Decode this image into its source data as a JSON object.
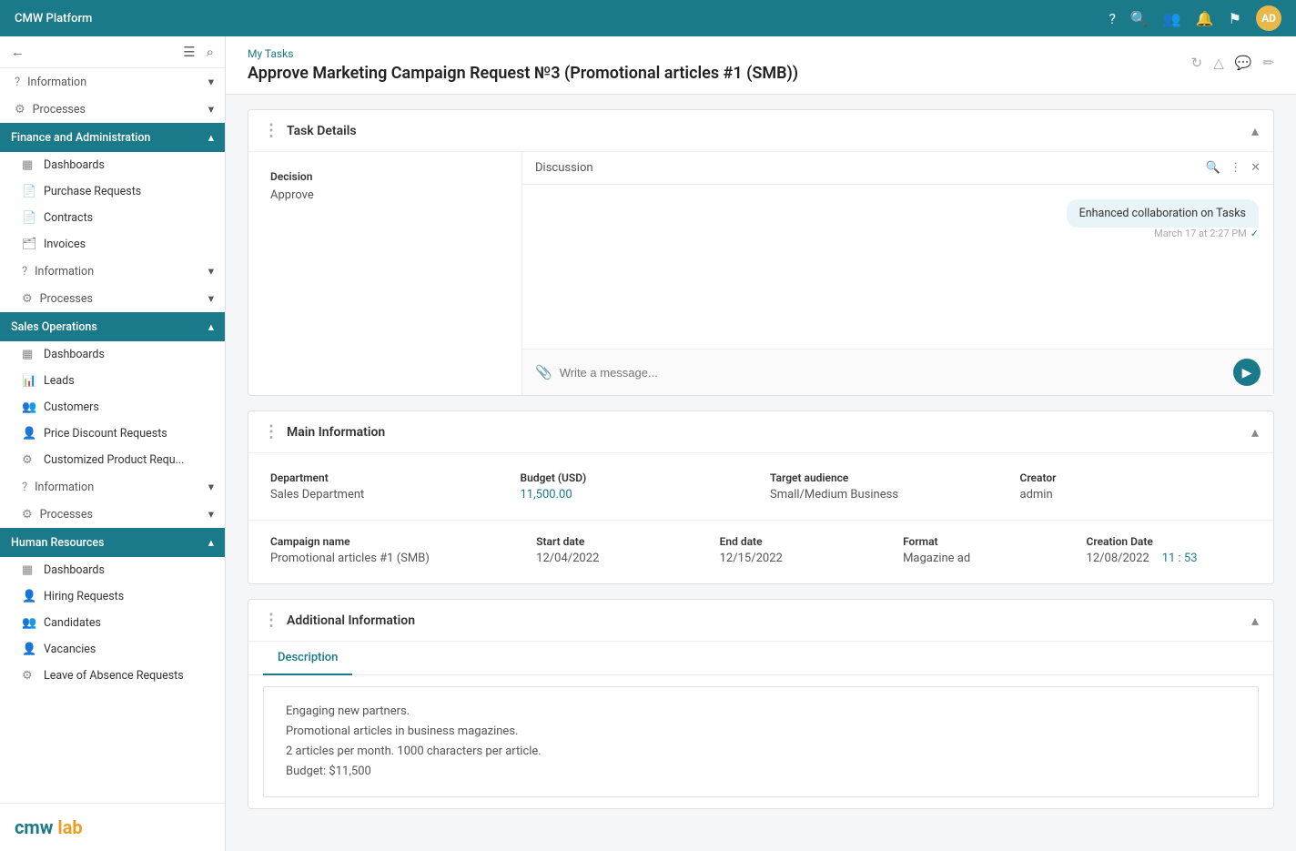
{
  "topbar": {
    "title": "CMW Platform",
    "avatar_initials": "AD"
  },
  "sidebar": {
    "logo_text": "cmw ",
    "logo_highlight": "lab",
    "back_icon": "←",
    "menu_icon": "☰",
    "search_icon": "🔍",
    "sections": [
      {
        "id": "information-top",
        "label": "Information",
        "active": false,
        "has_arrow": true,
        "type": "subsection"
      },
      {
        "id": "processes-top",
        "label": "Processes",
        "active": false,
        "has_arrow": true,
        "type": "subsection"
      },
      {
        "id": "finance",
        "label": "Finance and Administration",
        "active": true,
        "type": "section",
        "items": [
          {
            "id": "dashboards-fin",
            "label": "Dashboards",
            "icon": "▦"
          },
          {
            "id": "purchase-requests",
            "label": "Purchase Requests",
            "icon": "📄"
          },
          {
            "id": "contracts",
            "label": "Contracts",
            "icon": "📄"
          },
          {
            "id": "invoices",
            "label": "Invoices",
            "icon": "🗂"
          },
          {
            "id": "information-fin",
            "label": "Information",
            "icon": "?",
            "has_arrow": true
          },
          {
            "id": "processes-fin",
            "label": "Processes",
            "icon": "⚙",
            "has_arrow": true
          }
        ]
      },
      {
        "id": "sales",
        "label": "Sales Operations",
        "active": true,
        "type": "section",
        "items": [
          {
            "id": "dashboards-sales",
            "label": "Dashboards",
            "icon": "▦"
          },
          {
            "id": "leads",
            "label": "Leads",
            "icon": "📊"
          },
          {
            "id": "customers",
            "label": "Customers",
            "icon": "👥"
          },
          {
            "id": "price-discount",
            "label": "Price Discount Requests",
            "icon": "👤"
          },
          {
            "id": "customized-product",
            "label": "Customized Product Requ...",
            "icon": "⚙"
          },
          {
            "id": "information-sales",
            "label": "Information",
            "icon": "?",
            "has_arrow": true
          },
          {
            "id": "processes-sales",
            "label": "Processes",
            "icon": "⚙",
            "has_arrow": true
          }
        ]
      },
      {
        "id": "hr",
        "label": "Human Resources",
        "active": true,
        "type": "section",
        "items": [
          {
            "id": "dashboards-hr",
            "label": "Dashboards",
            "icon": "▦"
          },
          {
            "id": "hiring-requests",
            "label": "Hiring Requests",
            "icon": "👤+"
          },
          {
            "id": "candidates",
            "label": "Candidates",
            "icon": "👥"
          },
          {
            "id": "vacancies",
            "label": "Vacancies",
            "icon": "👤"
          },
          {
            "id": "leave-absence",
            "label": "Leave of Absence Requests",
            "icon": "⚙"
          }
        ]
      }
    ],
    "bottom_logo_text": "cmw ",
    "bottom_logo_highlight": "lab"
  },
  "header": {
    "breadcrumb": "My Tasks",
    "title": "Approve Marketing Campaign Request №3 (Promotional articles #1 (SMB))"
  },
  "task_details": {
    "section_title": "Task Details",
    "decision_label": "Decision",
    "decision_value": "Approve",
    "discussion_title": "Discussion",
    "message_text": "Enhanced collaboration on Tasks",
    "message_time": "March 17 at 2:27 PM",
    "input_placeholder": "Write a message..."
  },
  "main_information": {
    "section_title": "Main Information",
    "row1": [
      {
        "label": "Department",
        "value": "Sales Department",
        "blue": false
      },
      {
        "label": "Budget (USD)",
        "value": "11,500.00",
        "blue": true
      },
      {
        "label": "Target audience",
        "value": "Small/Medium Business",
        "blue": false
      },
      {
        "label": "Creator",
        "value": "admin",
        "blue": false
      }
    ],
    "row2": [
      {
        "label": "Campaign name",
        "value": "Promotional articles #1 (SMB)",
        "blue": false
      },
      {
        "label": "Start date",
        "value": "12/04/2022",
        "blue": false
      },
      {
        "label": "End date",
        "value": "12/15/2022",
        "blue": false
      },
      {
        "label": "Format",
        "value": "Magazine ad",
        "blue": false
      }
    ],
    "creation_label": "Creation Date",
    "creation_date": "12/08/2022",
    "creation_time": "11 : 53"
  },
  "additional_information": {
    "section_title": "Additional Information",
    "tabs": [
      "Description"
    ],
    "active_tab": "Description",
    "description_lines": [
      "Engaging new partners.",
      "Promotional articles in business magazines.",
      "2 articles per month. 1000 characters per article.",
      "Budget: $11,500"
    ]
  }
}
